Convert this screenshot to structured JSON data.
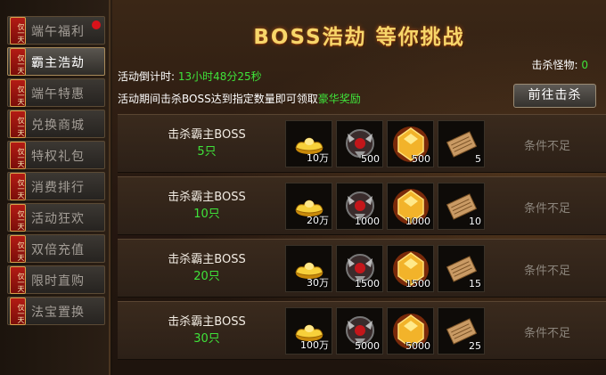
{
  "sidebar": {
    "tag": "仅一天",
    "items": [
      {
        "label": "端午福利",
        "active": false,
        "dot": true
      },
      {
        "label": "霸主浩劫",
        "active": true,
        "dot": false
      },
      {
        "label": "端午特惠",
        "active": false,
        "dot": false
      },
      {
        "label": "兑换商城",
        "active": false,
        "dot": false
      },
      {
        "label": "特权礼包",
        "active": false,
        "dot": false
      },
      {
        "label": "消费排行",
        "active": false,
        "dot": false
      },
      {
        "label": "活动狂欢",
        "active": false,
        "dot": false
      },
      {
        "label": "双倍充值",
        "active": false,
        "dot": false
      },
      {
        "label": "限时直购",
        "active": false,
        "dot": false
      },
      {
        "label": "法宝置换",
        "active": false,
        "dot": false
      }
    ]
  },
  "main": {
    "title": "BOSS浩劫 等你挑战",
    "countdown_label": "活动倒计时:",
    "countdown_value": "13小时48分25秒",
    "kills_label": "击杀怪物:",
    "kills_value": "0",
    "notice_text": "活动期间击杀BOSS达到指定数量即可领取",
    "notice_highlight": "豪华奖励",
    "goto_button": "前往击杀"
  },
  "rewards": [
    {
      "condition": "击杀霸主BOSS",
      "count": "5只",
      "status": "条件不足",
      "items": [
        {
          "icon": "gold-ingot-icon",
          "qty": "10万"
        },
        {
          "icon": "demon-mask-icon",
          "qty": "500"
        },
        {
          "icon": "golden-gem-icon",
          "qty": "500"
        },
        {
          "icon": "scroll-icon",
          "qty": "5"
        }
      ]
    },
    {
      "condition": "击杀霸主BOSS",
      "count": "10只",
      "status": "条件不足",
      "items": [
        {
          "icon": "gold-ingot-icon",
          "qty": "20万"
        },
        {
          "icon": "demon-mask-icon",
          "qty": "1000"
        },
        {
          "icon": "golden-gem-icon",
          "qty": "1000"
        },
        {
          "icon": "scroll-icon",
          "qty": "10"
        }
      ]
    },
    {
      "condition": "击杀霸主BOSS",
      "count": "20只",
      "status": "条件不足",
      "items": [
        {
          "icon": "gold-ingot-icon",
          "qty": "30万"
        },
        {
          "icon": "demon-mask-icon",
          "qty": "1500"
        },
        {
          "icon": "golden-gem-icon",
          "qty": "1500"
        },
        {
          "icon": "scroll-icon",
          "qty": "15"
        }
      ]
    },
    {
      "condition": "击杀霸主BOSS",
      "count": "30只",
      "status": "条件不足",
      "items": [
        {
          "icon": "gold-ingot-icon",
          "qty": "100万"
        },
        {
          "icon": "demon-mask-icon",
          "qty": "5000"
        },
        {
          "icon": "golden-gem-icon",
          "qty": "5000"
        },
        {
          "icon": "scroll-icon",
          "qty": "25"
        }
      ]
    }
  ],
  "colors": {
    "accent_green": "#3fe33a",
    "tag_red": "#b31b14",
    "title_gold": "#f7d66a"
  }
}
